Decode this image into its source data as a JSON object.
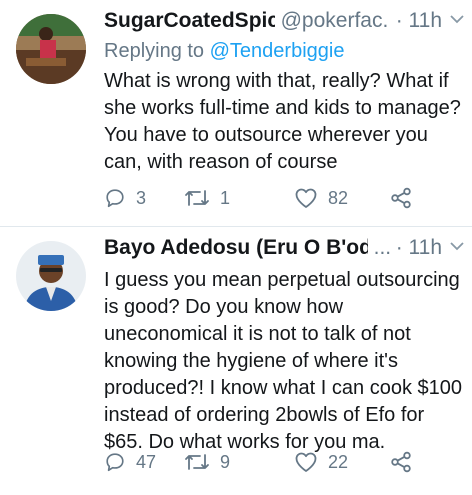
{
  "tweets": [
    {
      "display_name": "SugarCoatedSpice",
      "handle": "@pokerfac...",
      "time": "· 11h",
      "reply_prefix": "Replying to",
      "reply_mention": "@Tenderbiggie",
      "text": "What is wrong with that, really? What if she works full-time and kids to manage? You have to outsource wherever you can, with reason of course",
      "replies": "3",
      "retweets": "1",
      "likes": "82",
      "icons": [
        "reply-icon",
        "retweet-icon",
        "like-icon",
        "share-icon",
        "chevron-down-icon"
      ]
    },
    {
      "display_name": "Bayo Adedosu (Eru O B'odo)",
      "handle": "...",
      "time": "· 11h",
      "text": "I guess you mean perpetual outsourcing is good? Do you know how uneconomical it is not to talk of not knowing the hygiene of where it's produced?! I know what I can cook $100 instead of ordering 2bowls of Efo for $65. Do what works for you ma.",
      "replies": "47",
      "retweets": "9",
      "likes": "22",
      "icons": [
        "reply-icon",
        "retweet-icon",
        "like-icon",
        "share-icon",
        "chevron-down-icon"
      ]
    }
  ],
  "colors": {
    "text": "#14171a",
    "secondary": "#657786",
    "link": "#1da1f2",
    "divider": "#e1e8ed"
  }
}
